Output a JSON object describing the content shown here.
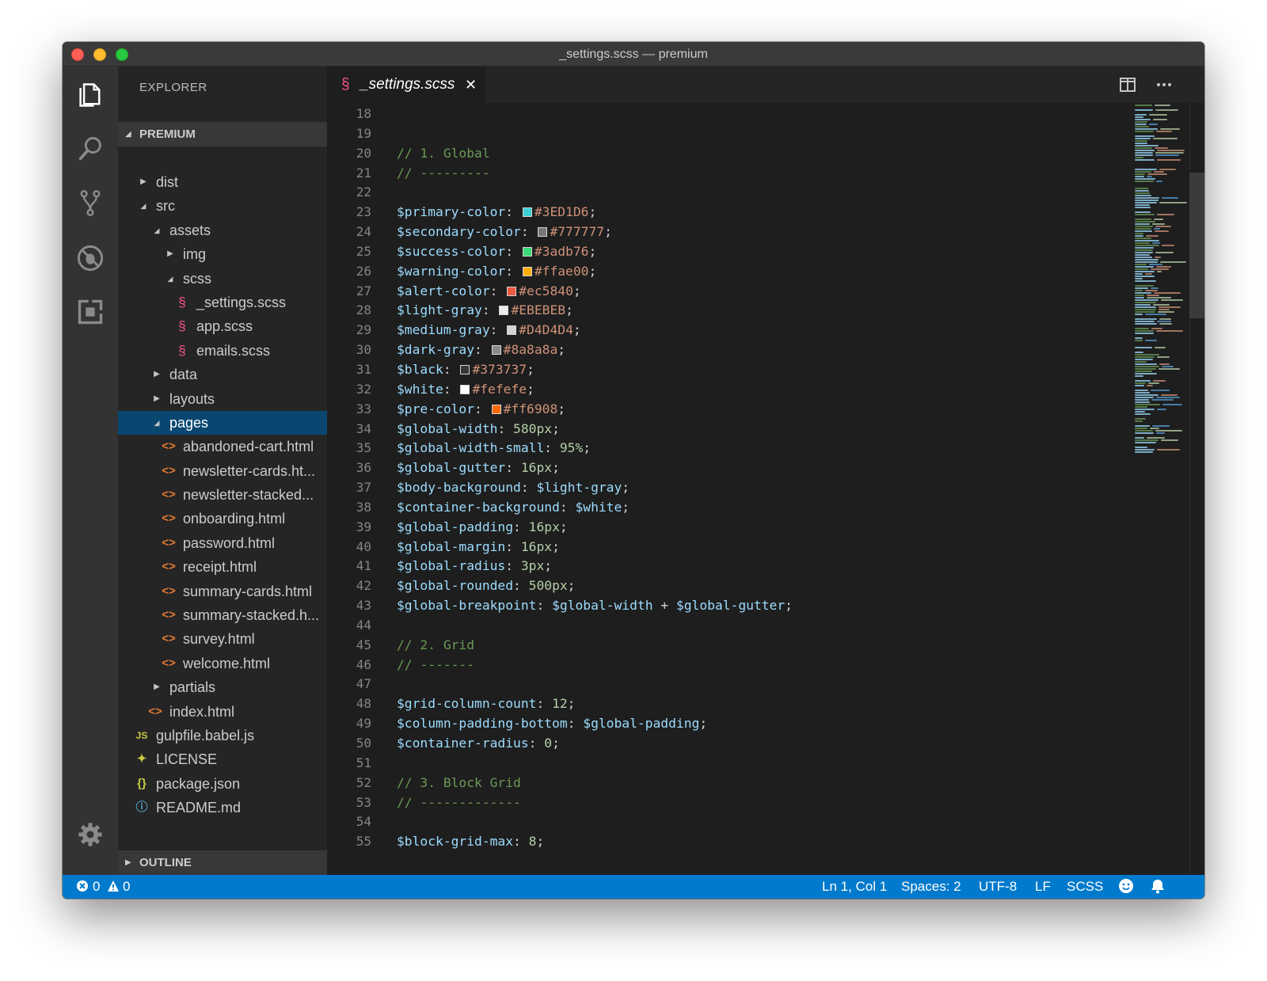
{
  "window": {
    "title": "_settings.scss — premium"
  },
  "sidebar": {
    "header": "EXPLORER",
    "root": "PREMIUM",
    "outline": "OUTLINE",
    "tree": [
      {
        "label": "dist",
        "depth": 0,
        "kind": "folder",
        "open": false
      },
      {
        "label": "src",
        "depth": 0,
        "kind": "folder",
        "open": true
      },
      {
        "label": "assets",
        "depth": 1,
        "kind": "folder",
        "open": true
      },
      {
        "label": "img",
        "depth": 2,
        "kind": "folder",
        "open": false
      },
      {
        "label": "scss",
        "depth": 2,
        "kind": "folder",
        "open": true
      },
      {
        "label": "_settings.scss",
        "depth": 3,
        "kind": "sass"
      },
      {
        "label": "app.scss",
        "depth": 3,
        "kind": "sass"
      },
      {
        "label": "emails.scss",
        "depth": 3,
        "kind": "sass"
      },
      {
        "label": "data",
        "depth": 1,
        "kind": "folder",
        "open": false
      },
      {
        "label": "layouts",
        "depth": 1,
        "kind": "folder",
        "open": false
      },
      {
        "label": "pages",
        "depth": 1,
        "kind": "folder",
        "open": true,
        "selected": true
      },
      {
        "label": "abandoned-cart.html",
        "depth": 2,
        "kind": "html"
      },
      {
        "label": "newsletter-cards.ht...",
        "depth": 2,
        "kind": "html"
      },
      {
        "label": "newsletter-stacked...",
        "depth": 2,
        "kind": "html"
      },
      {
        "label": "onboarding.html",
        "depth": 2,
        "kind": "html"
      },
      {
        "label": "password.html",
        "depth": 2,
        "kind": "html"
      },
      {
        "label": "receipt.html",
        "depth": 2,
        "kind": "html"
      },
      {
        "label": "summary-cards.html",
        "depth": 2,
        "kind": "html"
      },
      {
        "label": "summary-stacked.h...",
        "depth": 2,
        "kind": "html"
      },
      {
        "label": "survey.html",
        "depth": 2,
        "kind": "html"
      },
      {
        "label": "welcome.html",
        "depth": 2,
        "kind": "html"
      },
      {
        "label": "partials",
        "depth": 1,
        "kind": "folder",
        "open": false
      },
      {
        "label": "index.html",
        "depth": 1,
        "kind": "html"
      },
      {
        "label": "gulpfile.babel.js",
        "depth": 0,
        "kind": "js"
      },
      {
        "label": "LICENSE",
        "depth": 0,
        "kind": "license"
      },
      {
        "label": "package.json",
        "depth": 0,
        "kind": "json"
      },
      {
        "label": "README.md",
        "depth": 0,
        "kind": "info"
      }
    ]
  },
  "tab": {
    "label": "_settings.scss",
    "close": "✕"
  },
  "editor": {
    "line_numbers": [
      "18",
      "19",
      "20",
      "21",
      "22",
      "23",
      "24",
      "25",
      "26",
      "27",
      "28",
      "29",
      "30",
      "31",
      "32",
      "33",
      "34",
      "35",
      "36",
      "37",
      "38",
      "39",
      "40",
      "41",
      "42",
      "43",
      "44",
      "45",
      "46",
      "47",
      "48",
      "49",
      "50",
      "51",
      "52",
      "53",
      "54",
      "55"
    ],
    "lines": [
      [],
      [],
      [
        {
          "t": "// 1. Global",
          "c": "comment"
        }
      ],
      [
        {
          "t": "// ---------",
          "c": "comment"
        }
      ],
      [],
      [
        {
          "t": "$primary-color",
          "c": "var"
        },
        {
          "t": ": ",
          "c": "punct"
        },
        {
          "t": "",
          "c": "swatch",
          "color": "#3ED1D6"
        },
        {
          "t": "#3ED1D6",
          "c": "str"
        },
        {
          "t": ";",
          "c": "punct"
        }
      ],
      [
        {
          "t": "$secondary-color",
          "c": "var"
        },
        {
          "t": ": ",
          "c": "punct"
        },
        {
          "t": "",
          "c": "swatch",
          "color": "#777777"
        },
        {
          "t": "#777777",
          "c": "str"
        },
        {
          "t": ";",
          "c": "punct"
        }
      ],
      [
        {
          "t": "$success-color",
          "c": "var"
        },
        {
          "t": ": ",
          "c": "punct"
        },
        {
          "t": "",
          "c": "swatch",
          "color": "#3adb76"
        },
        {
          "t": "#3adb76",
          "c": "str"
        },
        {
          "t": ";",
          "c": "punct"
        }
      ],
      [
        {
          "t": "$warning-color",
          "c": "var"
        },
        {
          "t": ": ",
          "c": "punct"
        },
        {
          "t": "",
          "c": "swatch",
          "color": "#ffae00"
        },
        {
          "t": "#ffae00",
          "c": "str"
        },
        {
          "t": ";",
          "c": "punct"
        }
      ],
      [
        {
          "t": "$alert-color",
          "c": "var"
        },
        {
          "t": ": ",
          "c": "punct"
        },
        {
          "t": "",
          "c": "swatch",
          "color": "#ec5840"
        },
        {
          "t": "#ec5840",
          "c": "str"
        },
        {
          "t": ";",
          "c": "punct"
        }
      ],
      [
        {
          "t": "$light-gray",
          "c": "var"
        },
        {
          "t": ": ",
          "c": "punct"
        },
        {
          "t": "",
          "c": "swatch",
          "color": "#EBEBEB"
        },
        {
          "t": "#EBEBEB",
          "c": "str"
        },
        {
          "t": ";",
          "c": "punct"
        }
      ],
      [
        {
          "t": "$medium-gray",
          "c": "var"
        },
        {
          "t": ": ",
          "c": "punct"
        },
        {
          "t": "",
          "c": "swatch",
          "color": "#D4D4D4"
        },
        {
          "t": "#D4D4D4",
          "c": "str"
        },
        {
          "t": ";",
          "c": "punct"
        }
      ],
      [
        {
          "t": "$dark-gray",
          "c": "var"
        },
        {
          "t": ": ",
          "c": "punct"
        },
        {
          "t": "",
          "c": "swatch",
          "color": "#8a8a8a"
        },
        {
          "t": "#8a8a8a",
          "c": "str"
        },
        {
          "t": ";",
          "c": "punct"
        }
      ],
      [
        {
          "t": "$black",
          "c": "var"
        },
        {
          "t": ": ",
          "c": "punct"
        },
        {
          "t": "",
          "c": "swatch",
          "color": "#373737"
        },
        {
          "t": "#373737",
          "c": "str"
        },
        {
          "t": ";",
          "c": "punct"
        }
      ],
      [
        {
          "t": "$white",
          "c": "var"
        },
        {
          "t": ": ",
          "c": "punct"
        },
        {
          "t": "",
          "c": "swatch",
          "color": "#fefefe"
        },
        {
          "t": "#fefefe",
          "c": "str"
        },
        {
          "t": ";",
          "c": "punct"
        }
      ],
      [
        {
          "t": "$pre-color",
          "c": "var"
        },
        {
          "t": ": ",
          "c": "punct"
        },
        {
          "t": "",
          "c": "swatch",
          "color": "#ff6908"
        },
        {
          "t": "#ff6908",
          "c": "str"
        },
        {
          "t": ";",
          "c": "punct"
        }
      ],
      [
        {
          "t": "$global-width",
          "c": "var"
        },
        {
          "t": ": ",
          "c": "punct"
        },
        {
          "t": "580px",
          "c": "num"
        },
        {
          "t": ";",
          "c": "punct"
        }
      ],
      [
        {
          "t": "$global-width-small",
          "c": "var"
        },
        {
          "t": ": ",
          "c": "punct"
        },
        {
          "t": "95%",
          "c": "num"
        },
        {
          "t": ";",
          "c": "punct"
        }
      ],
      [
        {
          "t": "$global-gutter",
          "c": "var"
        },
        {
          "t": ": ",
          "c": "punct"
        },
        {
          "t": "16px",
          "c": "num"
        },
        {
          "t": ";",
          "c": "punct"
        }
      ],
      [
        {
          "t": "$body-background",
          "c": "var"
        },
        {
          "t": ": ",
          "c": "punct"
        },
        {
          "t": "$light-gray",
          "c": "var"
        },
        {
          "t": ";",
          "c": "punct"
        }
      ],
      [
        {
          "t": "$container-background",
          "c": "var"
        },
        {
          "t": ": ",
          "c": "punct"
        },
        {
          "t": "$white",
          "c": "var"
        },
        {
          "t": ";",
          "c": "punct"
        }
      ],
      [
        {
          "t": "$global-padding",
          "c": "var"
        },
        {
          "t": ": ",
          "c": "punct"
        },
        {
          "t": "16px",
          "c": "num"
        },
        {
          "t": ";",
          "c": "punct"
        }
      ],
      [
        {
          "t": "$global-margin",
          "c": "var"
        },
        {
          "t": ": ",
          "c": "punct"
        },
        {
          "t": "16px",
          "c": "num"
        },
        {
          "t": ";",
          "c": "punct"
        }
      ],
      [
        {
          "t": "$global-radius",
          "c": "var"
        },
        {
          "t": ": ",
          "c": "punct"
        },
        {
          "t": "3px",
          "c": "num"
        },
        {
          "t": ";",
          "c": "punct"
        }
      ],
      [
        {
          "t": "$global-rounded",
          "c": "var"
        },
        {
          "t": ": ",
          "c": "punct"
        },
        {
          "t": "500px",
          "c": "num"
        },
        {
          "t": ";",
          "c": "punct"
        }
      ],
      [
        {
          "t": "$global-breakpoint",
          "c": "var"
        },
        {
          "t": ": ",
          "c": "punct"
        },
        {
          "t": "$global-width",
          "c": "var"
        },
        {
          "t": " + ",
          "c": "punct"
        },
        {
          "t": "$global-gutter",
          "c": "var"
        },
        {
          "t": ";",
          "c": "punct"
        }
      ],
      [],
      [
        {
          "t": "// 2. Grid",
          "c": "comment"
        }
      ],
      [
        {
          "t": "// -------",
          "c": "comment"
        }
      ],
      [],
      [
        {
          "t": "$grid-column-count",
          "c": "var"
        },
        {
          "t": ": ",
          "c": "punct"
        },
        {
          "t": "12",
          "c": "num"
        },
        {
          "t": ";",
          "c": "punct"
        }
      ],
      [
        {
          "t": "$column-padding-bottom",
          "c": "var"
        },
        {
          "t": ": ",
          "c": "punct"
        },
        {
          "t": "$global-padding",
          "c": "var"
        },
        {
          "t": ";",
          "c": "punct"
        }
      ],
      [
        {
          "t": "$container-radius",
          "c": "var"
        },
        {
          "t": ": ",
          "c": "punct"
        },
        {
          "t": "0",
          "c": "num"
        },
        {
          "t": ";",
          "c": "punct"
        }
      ],
      [],
      [
        {
          "t": "// 3. Block Grid",
          "c": "comment"
        }
      ],
      [
        {
          "t": "// -------------",
          "c": "comment"
        }
      ],
      [],
      [
        {
          "t": "$block-grid-max",
          "c": "var"
        },
        {
          "t": ": ",
          "c": "punct"
        },
        {
          "t": "8",
          "c": "num"
        },
        {
          "t": ";",
          "c": "punct"
        }
      ]
    ]
  },
  "status": {
    "errors": "0",
    "warnings": "0",
    "position": "Ln 1, Col 1",
    "spaces": "Spaces: 2",
    "encoding": "UTF-8",
    "eol": "LF",
    "language": "SCSS"
  },
  "colors": {
    "accent": "#007acc",
    "selection": "#094771",
    "sass": "#f55385",
    "html": "#e37933",
    "js": "#cbcb41",
    "json": "#cbcb41",
    "info": "#519aba",
    "license": "#cbcb41"
  },
  "icons": {
    "activity": [
      "files-icon",
      "search-icon",
      "source-control-icon",
      "debug-icon",
      "extensions-icon",
      "gear-icon"
    ],
    "editor_actions": [
      "split-editor-icon",
      "more-icon"
    ],
    "status": [
      "error-icon",
      "warning-icon",
      "smiley-icon",
      "bell-icon"
    ]
  }
}
